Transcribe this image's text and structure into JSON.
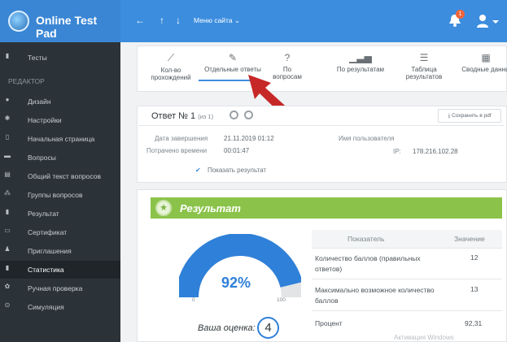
{
  "app": {
    "name": "Online Test Pad"
  },
  "topbar": {
    "nav": [
      {
        "icon": "arrow-left-icon",
        "glyph": "←"
      },
      {
        "icon": "arrow-up-icon",
        "glyph": "↑"
      },
      {
        "icon": "arrow-down-icon",
        "glyph": "↓"
      }
    ],
    "menu_label": "Меню сайта",
    "notification_count": "1"
  },
  "sidebar": {
    "top_item": "Тесты",
    "section_label": "РЕДАКТОР",
    "items": [
      {
        "label": "Дизайн",
        "icon": "palette-icon",
        "glyph": "●"
      },
      {
        "label": "Настройки",
        "icon": "gear-icon",
        "glyph": "✱"
      },
      {
        "label": "Начальная страница",
        "icon": "page-icon",
        "glyph": "▯"
      },
      {
        "label": "Вопросы",
        "icon": "questions-icon",
        "glyph": "▬"
      },
      {
        "label": "Общий текст вопросов",
        "icon": "text-icon",
        "glyph": "▤"
      },
      {
        "label": "Группы вопросов",
        "icon": "groups-icon",
        "glyph": "⁂"
      },
      {
        "label": "Результат",
        "icon": "chart-icon",
        "glyph": "▮"
      },
      {
        "label": "Сертификат",
        "icon": "certificate-icon",
        "glyph": "▭"
      },
      {
        "label": "Приглашения",
        "icon": "invite-icon",
        "glyph": "♟"
      },
      {
        "label": "Статистика",
        "icon": "statistics-icon",
        "glyph": "▮"
      },
      {
        "label": "Ручная проверка",
        "icon": "check-icon",
        "glyph": "✿"
      },
      {
        "label": "Симуляция",
        "icon": "simulation-icon",
        "glyph": "⊙"
      }
    ],
    "active_index": 9
  },
  "tabs": [
    {
      "label": "Кол-во прохождений",
      "icon": "line-chart-icon",
      "glyph": "⟋"
    },
    {
      "label": "Отдельные ответы",
      "icon": "edit-icon",
      "glyph": "✎"
    },
    {
      "label": "По вопросам",
      "icon": "question-icon",
      "glyph": "?"
    },
    {
      "label": "По результатам",
      "icon": "bar-chart-icon",
      "glyph": "▁▃▅"
    },
    {
      "label": "Таблица результатов",
      "icon": "table-icon",
      "glyph": "☰"
    },
    {
      "label": "Сводные данны",
      "icon": "grid-icon",
      "glyph": "▦"
    }
  ],
  "answer": {
    "title": "Ответ № 1",
    "count": "(из 1)",
    "save_label": "Сохранить в pdf",
    "completed_label": "Дата завершения",
    "completed_value": "21.11.2019 01:12",
    "time_label": "Потрачено времени",
    "time_value": "00:01:47",
    "user_label": "Имя пользователя",
    "ip_label": "IP:",
    "ip_value": "178.216.102.28",
    "show_result": "Показать результат"
  },
  "result": {
    "header": "Результат",
    "percent": "92%",
    "percent_value": 0.9231,
    "gauge_min": "0",
    "gauge_max": "100",
    "grade_label": "Ваша оценка:",
    "grade_value": "4",
    "table_headers": [
      "Показатель",
      "Значение"
    ],
    "rows": [
      {
        "name": "Количество баллов (правильных ответов)",
        "value": "12"
      },
      {
        "name": "Максимально возможное количество баллов",
        "value": "13"
      },
      {
        "name": "Процент",
        "value": "92,31"
      }
    ]
  },
  "watermark": "Активация Windows",
  "colors": {
    "topbar": "#3c8dde",
    "sidebar": "#2c3338",
    "gauge": "#2f80d8",
    "result_bar": "#8bc34a",
    "arrow": "#c62828"
  }
}
